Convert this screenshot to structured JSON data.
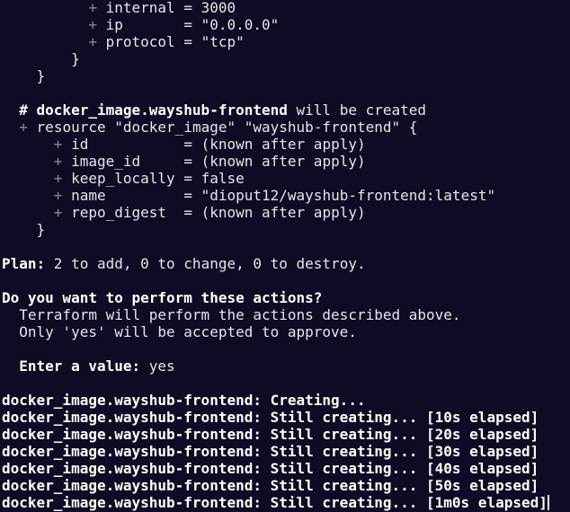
{
  "colors": {
    "background": "#0c0c24",
    "foreground": "#e6e6e6",
    "plus_marker": "#8a8a8a"
  },
  "prev_block": {
    "internal": {
      "marker": "+",
      "key": "internal",
      "eq": "= ",
      "value": "3000"
    },
    "ip": {
      "marker": "+",
      "key": "ip      ",
      "eq": "= ",
      "value": "\"0.0.0.0\""
    },
    "protocol": {
      "marker": "+",
      "key": "protocol",
      "eq": "= ",
      "value": "\"tcp\""
    },
    "inner_close": "}",
    "outer_close": "}"
  },
  "resource_block": {
    "comment_hash": "# ",
    "comment_name": "docker_image.wayshub-frontend",
    "comment_text": " will be created",
    "marker": "+",
    "header": "resource \"docker_image\" \"wayshub-frontend\" {",
    "attrs": [
      {
        "marker": "+",
        "key": "id           ",
        "eq": "= ",
        "value": "(known after apply)"
      },
      {
        "marker": "+",
        "key": "image_id     ",
        "eq": "= ",
        "value": "(known after apply)"
      },
      {
        "marker": "+",
        "key": "keep_locally ",
        "eq": "= ",
        "value": "false"
      },
      {
        "marker": "+",
        "key": "name         ",
        "eq": "= ",
        "value": "\"dioput12/wayshub-frontend:latest\""
      },
      {
        "marker": "+",
        "key": "repo_digest  ",
        "eq": "= ",
        "value": "(known after apply)"
      }
    ],
    "close": "}"
  },
  "plan": {
    "label": "Plan:",
    "text": " 2 to add, 0 to change, 0 to destroy."
  },
  "confirm": {
    "question": "Do you want to perform these actions?",
    "line1": "Terraform will perform the actions described above.",
    "line2": "Only 'yes' will be accepted to approve.",
    "prompt_label": "Enter a value:",
    "prompt_value": " yes"
  },
  "progress": [
    {
      "resource": "docker_image.wayshub-frontend:",
      "status": " Creating..."
    },
    {
      "resource": "docker_image.wayshub-frontend:",
      "status": " Still creating... [10s elapsed]"
    },
    {
      "resource": "docker_image.wayshub-frontend:",
      "status": " Still creating... [20s elapsed]"
    },
    {
      "resource": "docker_image.wayshub-frontend:",
      "status": " Still creating... [30s elapsed]"
    },
    {
      "resource": "docker_image.wayshub-frontend:",
      "status": " Still creating... [40s elapsed]"
    },
    {
      "resource": "docker_image.wayshub-frontend:",
      "status": " Still creating... [50s elapsed]"
    },
    {
      "resource": "docker_image.wayshub-frontend:",
      "status": " Still creating... [1m0s elapsed]"
    }
  ]
}
